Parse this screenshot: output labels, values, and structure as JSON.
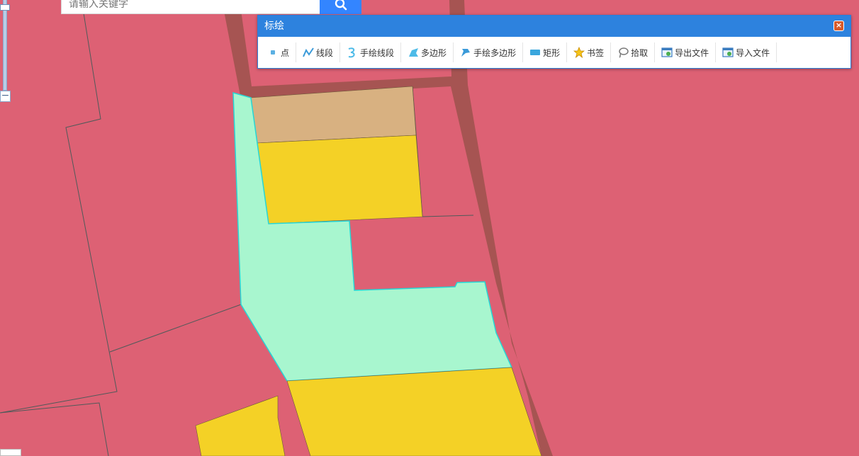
{
  "search": {
    "placeholder": "请输入关键字",
    "icon": "search-icon"
  },
  "zoom": {
    "out_symbol": "−"
  },
  "draw_panel": {
    "title": "标绘",
    "close_symbol": "×",
    "tools": [
      {
        "label": "点",
        "icon": "point-icon"
      },
      {
        "label": "线段",
        "icon": "polyline-icon"
      },
      {
        "label": "手绘线段",
        "icon": "freehand-line-icon"
      },
      {
        "label": "多边形",
        "icon": "polygon-icon"
      },
      {
        "label": "手绘多边形",
        "icon": "freehand-polygon-icon"
      },
      {
        "label": "矩形",
        "icon": "rectangle-icon"
      },
      {
        "label": "书签",
        "icon": "bookmark-star-icon"
      },
      {
        "label": "拾取",
        "icon": "pick-lasso-icon"
      },
      {
        "label": "导出文件",
        "icon": "export-file-icon"
      },
      {
        "label": "导入文件",
        "icon": "import-file-icon"
      }
    ]
  },
  "map_colors": {
    "background": "#dd6174",
    "road": "#a65452",
    "parcel_yellow": "#f4d126",
    "parcel_tan": "#d8b181",
    "selected_fill": "#a8f6cf",
    "selected_outline": "#26d6d6"
  }
}
